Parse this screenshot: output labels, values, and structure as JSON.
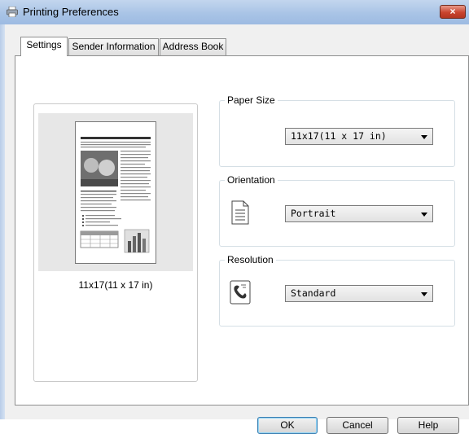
{
  "window": {
    "title": "Printing Preferences",
    "close_label": "×"
  },
  "tabs": [
    {
      "label": "Settings",
      "active": true
    },
    {
      "label": "Sender Information",
      "active": false
    },
    {
      "label": "Address Book",
      "active": false
    }
  ],
  "preview": {
    "caption": "11x17(11 x 17 in)"
  },
  "paper_size": {
    "title": "Paper Size",
    "selected": "11x17(11 x 17 in)"
  },
  "orientation": {
    "title": "Orientation",
    "selected": "Portrait",
    "icon": "portrait-page-icon"
  },
  "resolution": {
    "title": "Resolution",
    "selected": "Standard",
    "icon": "fax-resolution-icon"
  },
  "buttons": {
    "ok": "OK",
    "cancel": "Cancel",
    "help": "Help"
  }
}
